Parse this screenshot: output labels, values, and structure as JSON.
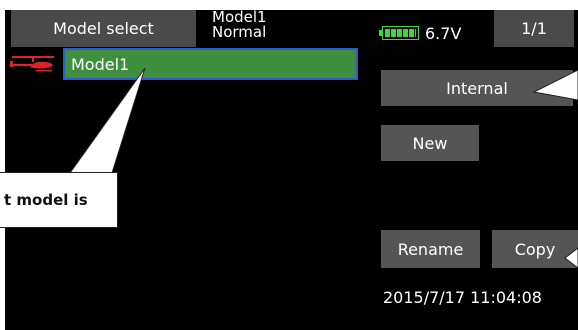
{
  "header": {
    "tab_label": "Model select",
    "model_name": "Model1",
    "model_condition": "Normal",
    "voltage": "6.7V",
    "page_indicator": "1/1"
  },
  "model_list": {
    "items": [
      {
        "label": "Model1",
        "icon": "helicopter-icon",
        "selected": true
      }
    ]
  },
  "buttons": {
    "internal": "Internal",
    "new": "New",
    "rename": "Rename",
    "copy": "Copy"
  },
  "status": {
    "datetime": "2015/7/17 11:04:08"
  },
  "callout": {
    "text": "t model is"
  },
  "colors": {
    "background": "#000000",
    "selected_row": "#3f8f3f",
    "selected_border": "#2a5bd6",
    "battery": "#3fd63f",
    "button": "#555555"
  }
}
